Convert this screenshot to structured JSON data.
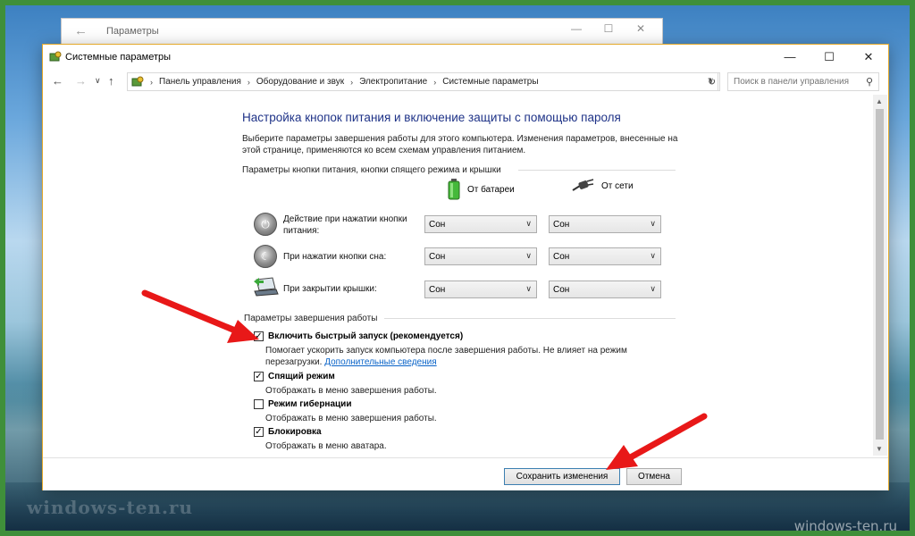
{
  "back_window": {
    "title": "Параметры"
  },
  "window": {
    "title": "Системные параметры",
    "controls": {
      "minimize": "—",
      "maximize": "☐",
      "close": "✕"
    }
  },
  "address_bar": {
    "breadcrumbs": [
      "Панель управления",
      "Оборудование и звук",
      "Электропитание",
      "Системные параметры"
    ],
    "search_placeholder": "Поиск в панели управления"
  },
  "page": {
    "heading": "Настройка кнопок питания и включение защиты с помощью пароля",
    "intro": "Выберите параметры завершения работы для этого компьютера. Изменения параметров, внесенные на этой странице, применяются ко всем схемам управления питанием.",
    "power_section_label": "Параметры кнопки питания, кнопки спящего режима и крышки",
    "col_battery": "От батареи",
    "col_ac": "От сети",
    "rows": [
      {
        "label": "Действие при нажатии кнопки питания:",
        "battery": "Сон",
        "ac": "Сон"
      },
      {
        "label": "При нажатии кнопки сна:",
        "battery": "Сон",
        "ac": "Сон"
      },
      {
        "label": "При закрытии крышки:",
        "battery": "Сон",
        "ac": "Сон"
      }
    ],
    "shutdown_section_label": "Параметры завершения работы",
    "options": [
      {
        "title": "Включить быстрый запуск (рекомендуется)",
        "checked": true,
        "desc": "Помогает ускорить запуск компьютера после завершения работы. Не влияет на режим перезагрузки.",
        "link": "Дополнительные сведения"
      },
      {
        "title": "Спящий режим",
        "checked": true,
        "desc": "Отображать в меню завершения работы."
      },
      {
        "title": "Режим гибернации",
        "checked": false,
        "desc": "Отображать в меню завершения работы."
      },
      {
        "title": "Блокировка",
        "checked": true,
        "desc": "Отображать в меню аватара."
      }
    ]
  },
  "footer": {
    "save_label": "Сохранить изменения",
    "cancel_label": "Отмена"
  },
  "watermark": {
    "left": "windows-ten.ru",
    "right": "windows-ten.ru"
  },
  "colors": {
    "heading": "#1e3287",
    "link": "#0a64c8",
    "annotation_arrow": "#e81818",
    "window_border": "#e3a82a",
    "frame": "#3f8f3a"
  }
}
